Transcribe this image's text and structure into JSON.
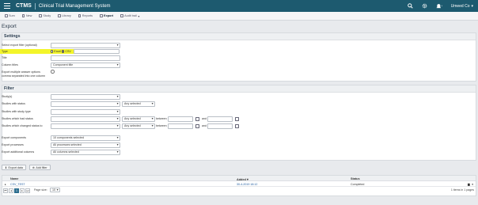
{
  "topbar": {
    "brand": "CTMS",
    "title": "Clinical Trial Management System",
    "user": "Umeed Co"
  },
  "toolbar": {
    "items": [
      {
        "label": "Sum",
        "icon": "home-icon"
      },
      {
        "label": "New",
        "icon": "plus-icon"
      },
      {
        "label": "Study",
        "icon": "study-icon"
      },
      {
        "label": "Library",
        "icon": "library-icon"
      },
      {
        "label": "Reports",
        "icon": "reports-icon"
      },
      {
        "label": "Export",
        "icon": "export-icon"
      },
      {
        "label": "Audit trail",
        "icon": "audit-icon"
      }
    ]
  },
  "page_title": "Export",
  "settings": {
    "header": "Settings",
    "export_filter_label": "Select export filter (optional)",
    "type_label": "Type",
    "type_options": [
      "Excel",
      "CSV"
    ],
    "title_label": "Title",
    "column_titles_label": "Column titles",
    "column_titles_value": "Component title",
    "multi_label_1": "Export multiple answer options",
    "multi_label_2": "comma separated into one column"
  },
  "filter": {
    "header": "Filter",
    "studies_label": "Study(s)",
    "studies_status_label": "Studies with status",
    "studies_status_any": "Any selected",
    "studies_type_label": "Studies with study type",
    "studies_had_status_label": "Studies which had status",
    "studies_had_status_any": "Any selected",
    "between": "between",
    "and": "and",
    "studies_changed_label": "Studies which changed status to",
    "studies_changed_any": "Any selected",
    "export_components_label": "Export components",
    "export_components_value": "10 components selected",
    "export_processes_label": "Export processes",
    "export_processes_value": "All processes selected",
    "export_columns_label": "Export additional columns",
    "export_columns_value": "All columns selected"
  },
  "buttons": {
    "export_data": "Export data",
    "add_filter": "Add filter"
  },
  "grid": {
    "columns": [
      "Name",
      "Added",
      "Status"
    ],
    "rows": [
      {
        "name": "CSV_TEST",
        "added": "30-4-2019 18:12",
        "status": "Completed"
      }
    ],
    "page": "1",
    "page_size_label": "Page size:",
    "page_size": "10",
    "summary": "1 items in 1 pages"
  },
  "colors": {
    "topbar": "#1d5a6f",
    "highlight": "#f3f52a",
    "accent": "#2c6d8e"
  }
}
